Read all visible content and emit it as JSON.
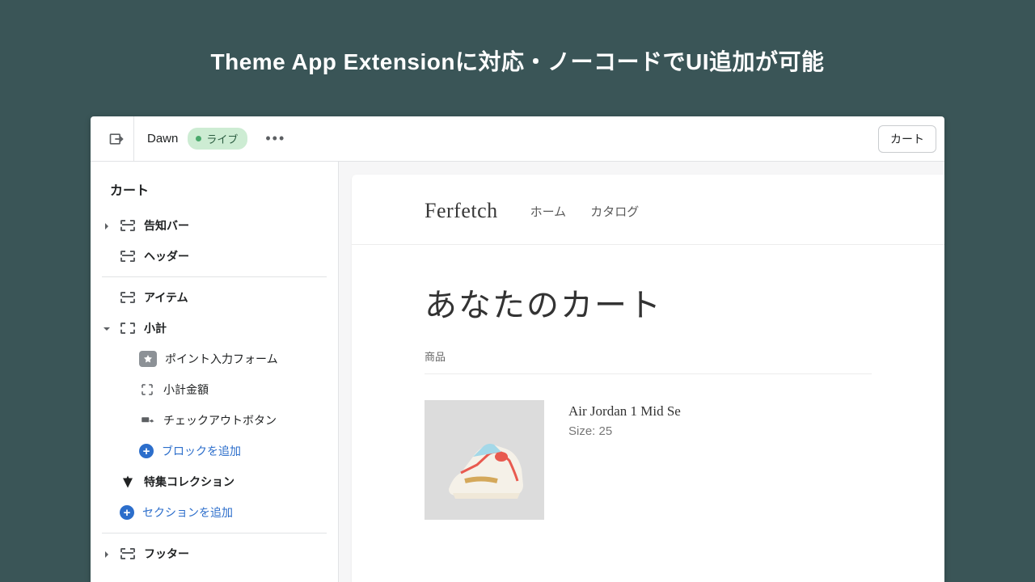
{
  "banner": {
    "title": "Theme App Extensionに対応・ノーコードでUI追加が可能"
  },
  "topbar": {
    "theme_name": "Dawn",
    "live_label": "ライブ",
    "cart_button": "カート"
  },
  "sidebar": {
    "heading": "カート",
    "sections": {
      "announcement": "告知バー",
      "header": "ヘッダー",
      "items": "アイテム",
      "subtotal": "小計",
      "featured": "特集コレクション",
      "footer": "フッター"
    },
    "subtotal_children": {
      "point_form": "ポイント入力フォーム",
      "subtotal_amount": "小計金額",
      "checkout_button": "チェックアウトボタン",
      "add_block": "ブロックを追加"
    },
    "add_section": "セクションを追加"
  },
  "preview": {
    "store_name": "Ferfetch",
    "nav": {
      "home": "ホーム",
      "catalog": "カタログ"
    },
    "cart_title": "あなたのカート",
    "col_product": "商品",
    "product": {
      "name": "Air Jordan 1 Mid Se",
      "size": "Size: 25"
    }
  }
}
